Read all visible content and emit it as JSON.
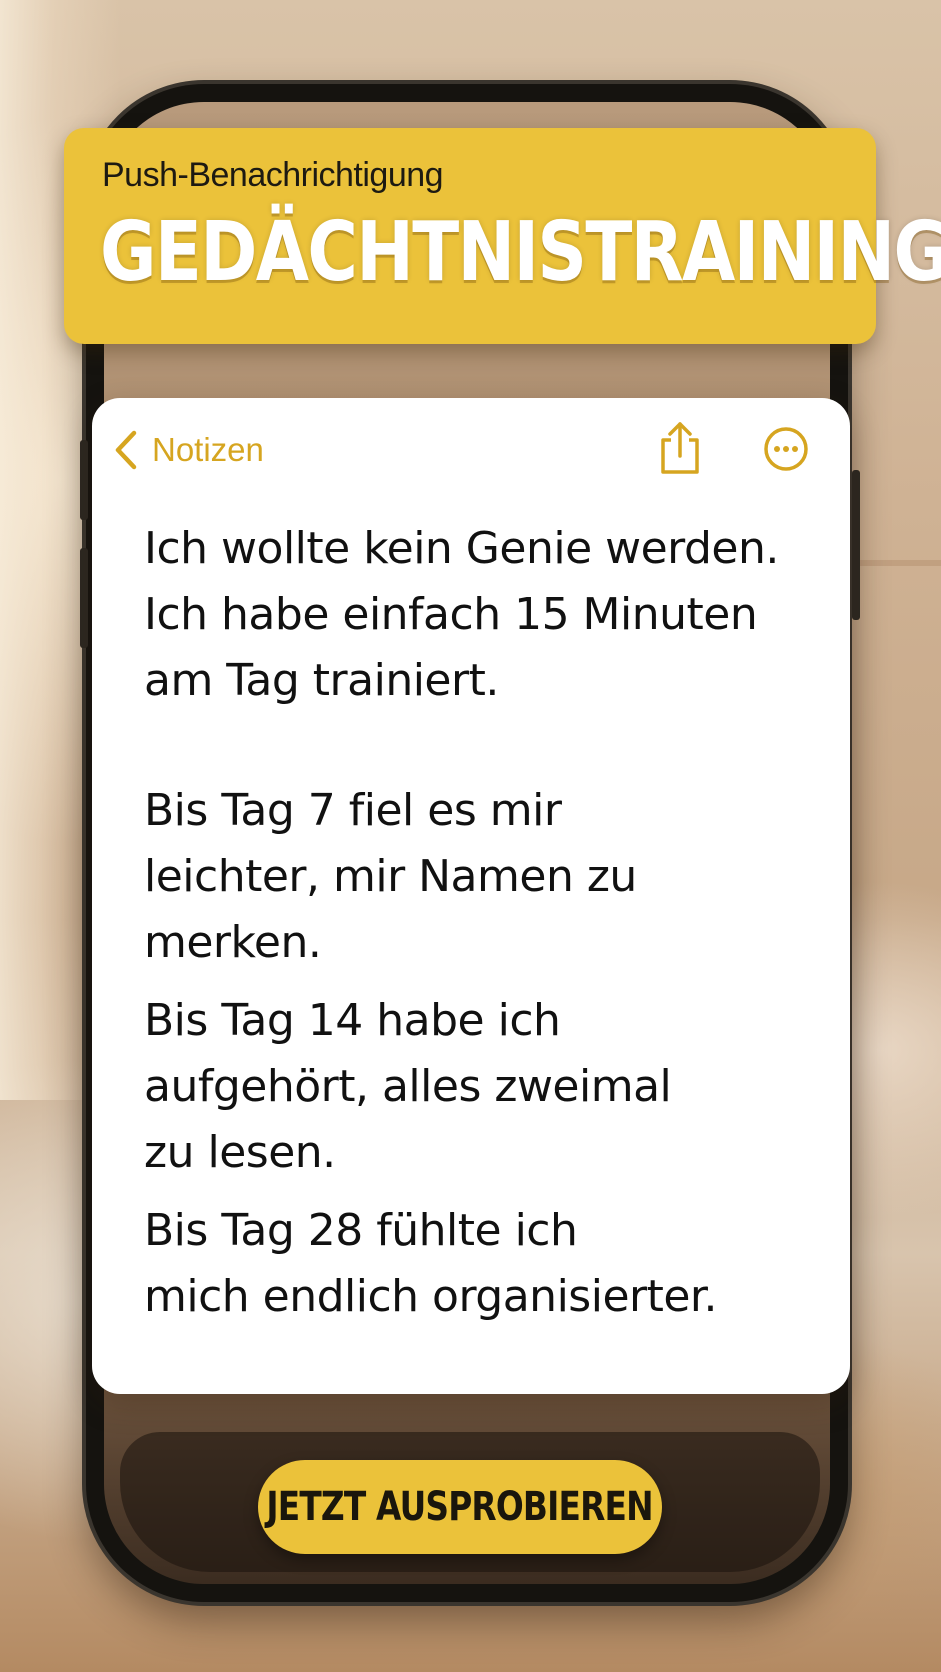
{
  "banner": {
    "subtitle": "Push-Benachrichtigung",
    "title": "GEDÄCHTNISTRAINING"
  },
  "note": {
    "back_label": "Notizen",
    "back_icon": "chevron-left-icon",
    "share_icon": "share-icon",
    "more_icon": "ellipsis-circle-icon",
    "paragraphs": [
      [
        "Ich wollte kein Genie werden.",
        "Ich habe einfach 15 Minuten",
        "am Tag trainiert."
      ],
      [
        "Bis Tag 7 fiel es mir",
        "leichter, mir Namen zu",
        "merken."
      ],
      [
        "Bis Tag 14 habe ich",
        "aufgehört, alles zweimal",
        "zu lesen."
      ],
      [
        "Bis Tag 28 fühlte ich",
        "mich endlich organisierter."
      ]
    ]
  },
  "cta": {
    "label": "JETZT AUSPROBIEREN"
  },
  "colors": {
    "accent": "#ebc23a",
    "icon_gold": "#d6a520",
    "note_bg": "#ffffff",
    "text": "#111111"
  }
}
